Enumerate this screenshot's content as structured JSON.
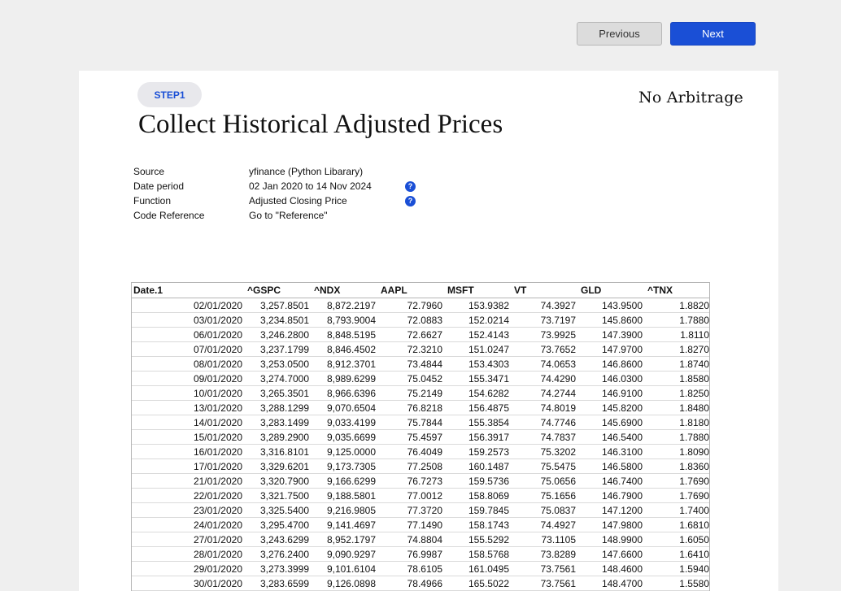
{
  "nav": {
    "previous_label": "Previous",
    "next_label": "Next"
  },
  "step": "STEP1",
  "brand": "No Arbitrage",
  "title": "Collect Historical Adjusted Prices",
  "info": [
    {
      "label": "Source",
      "value": "yfinance (Python Libarary)",
      "help": false
    },
    {
      "label": "Date period",
      "value": "02 Jan 2020 to 14 Nov 2024",
      "help": true
    },
    {
      "label": "Function",
      "value": "Adjusted Closing Price",
      "help": true
    },
    {
      "label": "Code Reference",
      "value": "Go to \"Reference\"",
      "help": false
    }
  ],
  "help_icon": "question-circle-icon",
  "table": {
    "columns": [
      "Date.1",
      "^GSPC",
      "^NDX",
      "AAPL",
      "MSFT",
      "VT",
      "GLD",
      "^TNX"
    ],
    "rows": [
      [
        "02/01/2020",
        "3,257.8501",
        "8,872.2197",
        "72.7960",
        "153.9382",
        "74.3927",
        "143.9500",
        "1.8820"
      ],
      [
        "03/01/2020",
        "3,234.8501",
        "8,793.9004",
        "72.0883",
        "152.0214",
        "73.7197",
        "145.8600",
        "1.7880"
      ],
      [
        "06/01/2020",
        "3,246.2800",
        "8,848.5195",
        "72.6627",
        "152.4143",
        "73.9925",
        "147.3900",
        "1.8110"
      ],
      [
        "07/01/2020",
        "3,237.1799",
        "8,846.4502",
        "72.3210",
        "151.0247",
        "73.7652",
        "147.9700",
        "1.8270"
      ],
      [
        "08/01/2020",
        "3,253.0500",
        "8,912.3701",
        "73.4844",
        "153.4303",
        "74.0653",
        "146.8600",
        "1.8740"
      ],
      [
        "09/01/2020",
        "3,274.7000",
        "8,989.6299",
        "75.0452",
        "155.3471",
        "74.4290",
        "146.0300",
        "1.8580"
      ],
      [
        "10/01/2020",
        "3,265.3501",
        "8,966.6396",
        "75.2149",
        "154.6282",
        "74.2744",
        "146.9100",
        "1.8250"
      ],
      [
        "13/01/2020",
        "3,288.1299",
        "9,070.6504",
        "76.8218",
        "156.4875",
        "74.8019",
        "145.8200",
        "1.8480"
      ],
      [
        "14/01/2020",
        "3,283.1499",
        "9,033.4199",
        "75.7844",
        "155.3854",
        "74.7746",
        "145.6900",
        "1.8180"
      ],
      [
        "15/01/2020",
        "3,289.2900",
        "9,035.6699",
        "75.4597",
        "156.3917",
        "74.7837",
        "146.5400",
        "1.7880"
      ],
      [
        "16/01/2020",
        "3,316.8101",
        "9,125.0000",
        "76.4049",
        "159.2573",
        "75.3202",
        "146.3100",
        "1.8090"
      ],
      [
        "17/01/2020",
        "3,329.6201",
        "9,173.7305",
        "77.2508",
        "160.1487",
        "75.5475",
        "146.5800",
        "1.8360"
      ],
      [
        "21/01/2020",
        "3,320.7900",
        "9,166.6299",
        "76.7273",
        "159.5736",
        "75.0656",
        "146.7400",
        "1.7690"
      ],
      [
        "22/01/2020",
        "3,321.7500",
        "9,188.5801",
        "77.0012",
        "158.8069",
        "75.1656",
        "146.7900",
        "1.7690"
      ],
      [
        "23/01/2020",
        "3,325.5400",
        "9,216.9805",
        "77.3720",
        "159.7845",
        "75.0837",
        "147.1200",
        "1.7400"
      ],
      [
        "24/01/2020",
        "3,295.4700",
        "9,141.4697",
        "77.1490",
        "158.1743",
        "74.4927",
        "147.9800",
        "1.6810"
      ],
      [
        "27/01/2020",
        "3,243.6299",
        "8,952.1797",
        "74.8804",
        "155.5292",
        "73.1105",
        "148.9900",
        "1.6050"
      ],
      [
        "28/01/2020",
        "3,276.2400",
        "9,090.9297",
        "76.9987",
        "158.5768",
        "73.8289",
        "147.6600",
        "1.6410"
      ],
      [
        "29/01/2020",
        "3,273.3999",
        "9,101.6104",
        "78.6105",
        "161.0495",
        "73.7561",
        "148.4600",
        "1.5940"
      ],
      [
        "30/01/2020",
        "3,283.6599",
        "9,126.0898",
        "78.4966",
        "165.5022",
        "73.7561",
        "148.4700",
        "1.5580"
      ]
    ]
  }
}
